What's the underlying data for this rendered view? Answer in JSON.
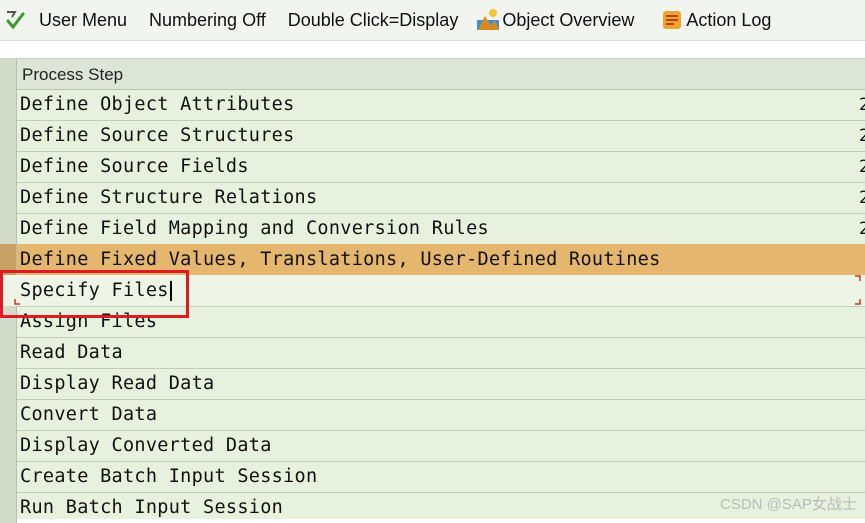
{
  "toolbar": {
    "execute_icon": "execute-checkmark-icon",
    "user_menu": "User Menu",
    "numbering_off": "Numbering Off",
    "double_click": "Double Click=Display",
    "object_overview": "Object Overview",
    "object_overview_icon": "object-overview-icon",
    "action_log": "Action Log",
    "action_log_icon": "action-log-icon"
  },
  "table": {
    "header": "Process Step",
    "rows": [
      "Define Object Attributes",
      "Define Source Structures",
      "Define Source Fields",
      "Define Structure Relations",
      "Define Field Mapping and Conversion Rules",
      "Define Fixed Values, Translations, User-Defined Routines",
      "Specify Files",
      "Assign Files",
      "Read Data",
      "Display Read Data",
      "Convert Data",
      "Display Converted Data",
      "Create Batch Input Session",
      "Run Batch Input Session"
    ],
    "clipped_marker": "2",
    "highlighted_index": 5,
    "editing_index": 6
  },
  "colors": {
    "highlight": "#e4b66e",
    "row_bg": "#e8f1de",
    "annotation_red": "#e01a22"
  },
  "watermark": "CSDN @SAP女战士"
}
